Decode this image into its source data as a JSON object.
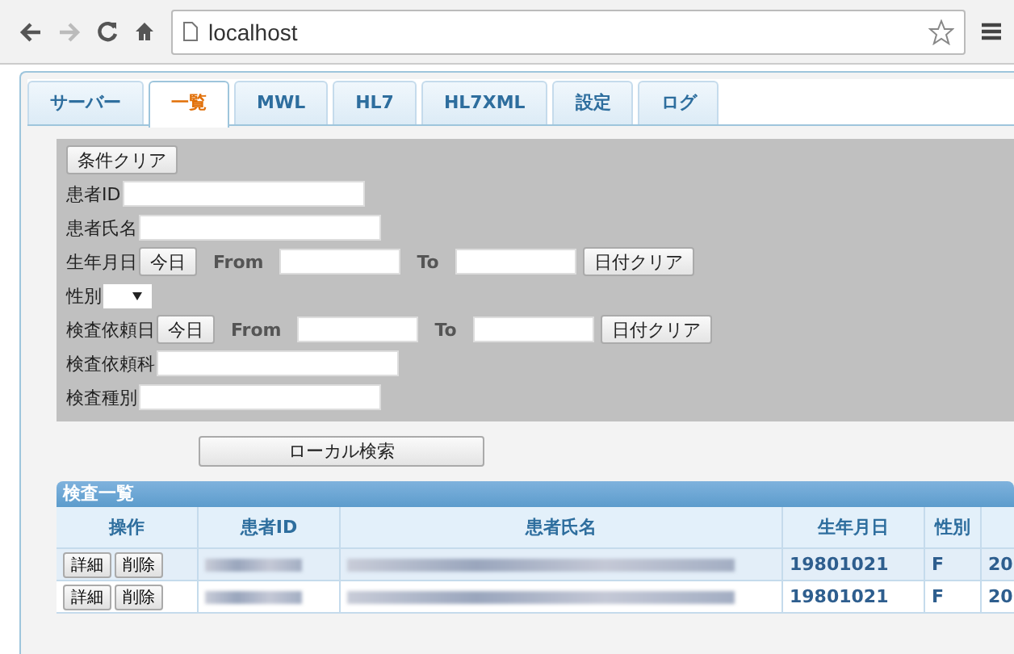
{
  "browser": {
    "address": "localhost"
  },
  "tabs": [
    {
      "label": "サーバー",
      "selected": false
    },
    {
      "label": "一覧",
      "selected": true
    },
    {
      "label": "MWL",
      "selected": false
    },
    {
      "label": "HL7",
      "selected": false
    },
    {
      "label": "HL7XML",
      "selected": false
    },
    {
      "label": "設定",
      "selected": false
    },
    {
      "label": "ログ",
      "selected": false
    }
  ],
  "form": {
    "clear_button": "条件クリア",
    "rows": [
      {
        "kind": "text",
        "label": "患者ID"
      },
      {
        "kind": "text",
        "label": "患者氏名"
      },
      {
        "kind": "date",
        "label": "生年月日",
        "today": "今日",
        "from": "From",
        "to": "To",
        "clear": "日付クリア"
      },
      {
        "kind": "select",
        "label": "性別"
      },
      {
        "kind": "date",
        "label": "検査依頼日",
        "today": "今日",
        "from": "From",
        "to": "To",
        "clear": "日付クリア"
      },
      {
        "kind": "text",
        "label": "検査依頼科"
      },
      {
        "kind": "text",
        "label": "検査種別"
      }
    ]
  },
  "search_button": "ローカル検索",
  "table": {
    "title": "検査一覧",
    "columns": [
      "操作",
      "患者ID",
      "患者氏名",
      "生年月日",
      "性別"
    ],
    "rows": [
      {
        "selected": true,
        "actions": [
          "詳細",
          "削除"
        ],
        "birth": "19801021",
        "sex": "F",
        "column_6": "20"
      },
      {
        "selected": false,
        "actions": [
          "詳細",
          "削除"
        ],
        "birth": "19801021",
        "sex": "F",
        "column_6": "20"
      }
    ]
  }
}
